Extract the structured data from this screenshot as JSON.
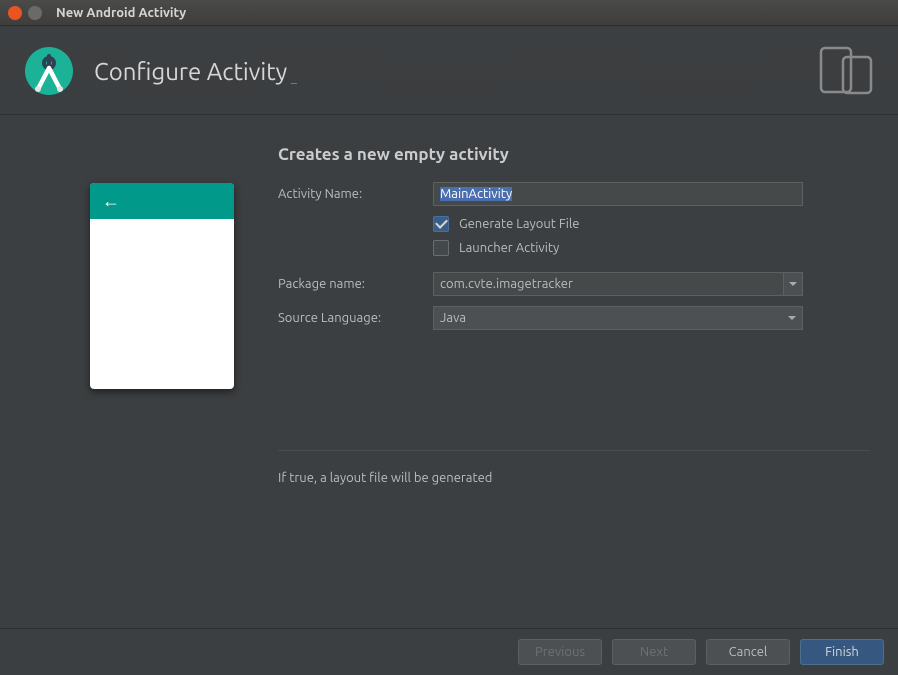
{
  "window": {
    "title": "New Android Activity"
  },
  "header": {
    "title": "Configure Activity"
  },
  "form": {
    "section_title": "Creates a new empty activity",
    "activity_name": {
      "label": "Activity Name:",
      "value": "MainActivity"
    },
    "generate_layout": {
      "label": "Generate Layout File",
      "checked": true
    },
    "launcher": {
      "label": "Launcher Activity",
      "checked": false
    },
    "package_name": {
      "label": "Package name:",
      "value": "com.cvte.imagetracker"
    },
    "source_language": {
      "label": "Source Language:",
      "value": "Java"
    },
    "hint": "If true, a layout file will be generated"
  },
  "footer": {
    "previous": "Previous",
    "next": "Next",
    "cancel": "Cancel",
    "finish": "Finish"
  }
}
